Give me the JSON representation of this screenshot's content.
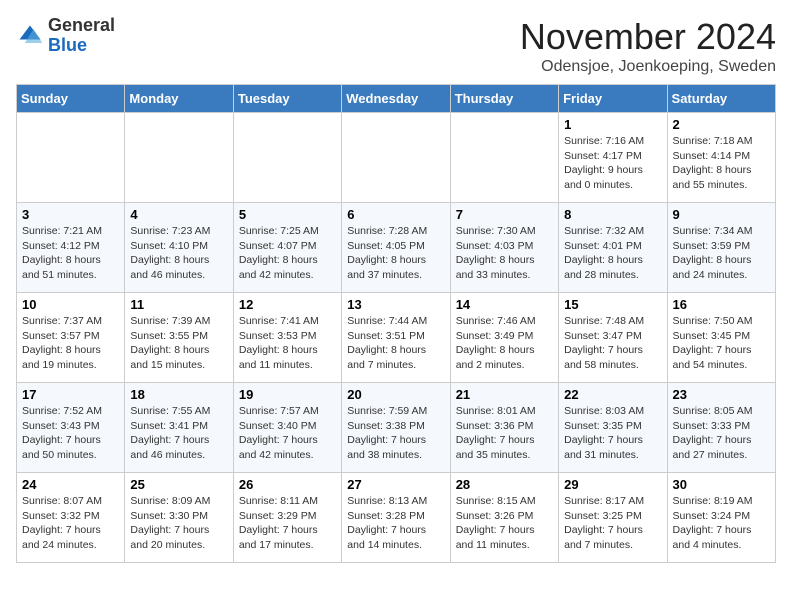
{
  "header": {
    "logo_general": "General",
    "logo_blue": "Blue",
    "month": "November 2024",
    "location": "Odensjoe, Joenkoeping, Sweden"
  },
  "weekdays": [
    "Sunday",
    "Monday",
    "Tuesday",
    "Wednesday",
    "Thursday",
    "Friday",
    "Saturday"
  ],
  "weeks": [
    [
      {
        "day": "",
        "info": ""
      },
      {
        "day": "",
        "info": ""
      },
      {
        "day": "",
        "info": ""
      },
      {
        "day": "",
        "info": ""
      },
      {
        "day": "",
        "info": ""
      },
      {
        "day": "1",
        "info": "Sunrise: 7:16 AM\nSunset: 4:17 PM\nDaylight: 9 hours\nand 0 minutes."
      },
      {
        "day": "2",
        "info": "Sunrise: 7:18 AM\nSunset: 4:14 PM\nDaylight: 8 hours\nand 55 minutes."
      }
    ],
    [
      {
        "day": "3",
        "info": "Sunrise: 7:21 AM\nSunset: 4:12 PM\nDaylight: 8 hours\nand 51 minutes."
      },
      {
        "day": "4",
        "info": "Sunrise: 7:23 AM\nSunset: 4:10 PM\nDaylight: 8 hours\nand 46 minutes."
      },
      {
        "day": "5",
        "info": "Sunrise: 7:25 AM\nSunset: 4:07 PM\nDaylight: 8 hours\nand 42 minutes."
      },
      {
        "day": "6",
        "info": "Sunrise: 7:28 AM\nSunset: 4:05 PM\nDaylight: 8 hours\nand 37 minutes."
      },
      {
        "day": "7",
        "info": "Sunrise: 7:30 AM\nSunset: 4:03 PM\nDaylight: 8 hours\nand 33 minutes."
      },
      {
        "day": "8",
        "info": "Sunrise: 7:32 AM\nSunset: 4:01 PM\nDaylight: 8 hours\nand 28 minutes."
      },
      {
        "day": "9",
        "info": "Sunrise: 7:34 AM\nSunset: 3:59 PM\nDaylight: 8 hours\nand 24 minutes."
      }
    ],
    [
      {
        "day": "10",
        "info": "Sunrise: 7:37 AM\nSunset: 3:57 PM\nDaylight: 8 hours\nand 19 minutes."
      },
      {
        "day": "11",
        "info": "Sunrise: 7:39 AM\nSunset: 3:55 PM\nDaylight: 8 hours\nand 15 minutes."
      },
      {
        "day": "12",
        "info": "Sunrise: 7:41 AM\nSunset: 3:53 PM\nDaylight: 8 hours\nand 11 minutes."
      },
      {
        "day": "13",
        "info": "Sunrise: 7:44 AM\nSunset: 3:51 PM\nDaylight: 8 hours\nand 7 minutes."
      },
      {
        "day": "14",
        "info": "Sunrise: 7:46 AM\nSunset: 3:49 PM\nDaylight: 8 hours\nand 2 minutes."
      },
      {
        "day": "15",
        "info": "Sunrise: 7:48 AM\nSunset: 3:47 PM\nDaylight: 7 hours\nand 58 minutes."
      },
      {
        "day": "16",
        "info": "Sunrise: 7:50 AM\nSunset: 3:45 PM\nDaylight: 7 hours\nand 54 minutes."
      }
    ],
    [
      {
        "day": "17",
        "info": "Sunrise: 7:52 AM\nSunset: 3:43 PM\nDaylight: 7 hours\nand 50 minutes."
      },
      {
        "day": "18",
        "info": "Sunrise: 7:55 AM\nSunset: 3:41 PM\nDaylight: 7 hours\nand 46 minutes."
      },
      {
        "day": "19",
        "info": "Sunrise: 7:57 AM\nSunset: 3:40 PM\nDaylight: 7 hours\nand 42 minutes."
      },
      {
        "day": "20",
        "info": "Sunrise: 7:59 AM\nSunset: 3:38 PM\nDaylight: 7 hours\nand 38 minutes."
      },
      {
        "day": "21",
        "info": "Sunrise: 8:01 AM\nSunset: 3:36 PM\nDaylight: 7 hours\nand 35 minutes."
      },
      {
        "day": "22",
        "info": "Sunrise: 8:03 AM\nSunset: 3:35 PM\nDaylight: 7 hours\nand 31 minutes."
      },
      {
        "day": "23",
        "info": "Sunrise: 8:05 AM\nSunset: 3:33 PM\nDaylight: 7 hours\nand 27 minutes."
      }
    ],
    [
      {
        "day": "24",
        "info": "Sunrise: 8:07 AM\nSunset: 3:32 PM\nDaylight: 7 hours\nand 24 minutes."
      },
      {
        "day": "25",
        "info": "Sunrise: 8:09 AM\nSunset: 3:30 PM\nDaylight: 7 hours\nand 20 minutes."
      },
      {
        "day": "26",
        "info": "Sunrise: 8:11 AM\nSunset: 3:29 PM\nDaylight: 7 hours\nand 17 minutes."
      },
      {
        "day": "27",
        "info": "Sunrise: 8:13 AM\nSunset: 3:28 PM\nDaylight: 7 hours\nand 14 minutes."
      },
      {
        "day": "28",
        "info": "Sunrise: 8:15 AM\nSunset: 3:26 PM\nDaylight: 7 hours\nand 11 minutes."
      },
      {
        "day": "29",
        "info": "Sunrise: 8:17 AM\nSunset: 3:25 PM\nDaylight: 7 hours\nand 7 minutes."
      },
      {
        "day": "30",
        "info": "Sunrise: 8:19 AM\nSunset: 3:24 PM\nDaylight: 7 hours\nand 4 minutes."
      }
    ]
  ]
}
